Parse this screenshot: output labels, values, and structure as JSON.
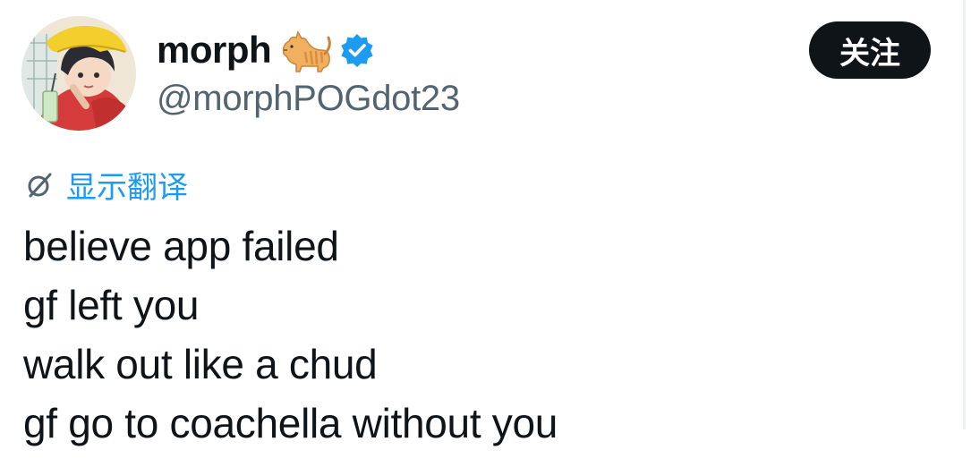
{
  "author": {
    "display_name": "morph",
    "handle": "@morphPOGdot23",
    "verified": true,
    "name_emoji": "cat-icon"
  },
  "actions": {
    "follow_label": "关注"
  },
  "translate": {
    "label": "显示翻译",
    "icon": "globe-icon"
  },
  "tweet": {
    "lines": [
      "believe app failed",
      "gf left you",
      "walk out like a chud",
      "gf go to coachella without you"
    ]
  },
  "colors": {
    "accent": "#1d9bf0",
    "text": "#0f1419",
    "secondary_text": "#536471",
    "button_bg": "#0f1419",
    "button_text": "#ffffff"
  }
}
